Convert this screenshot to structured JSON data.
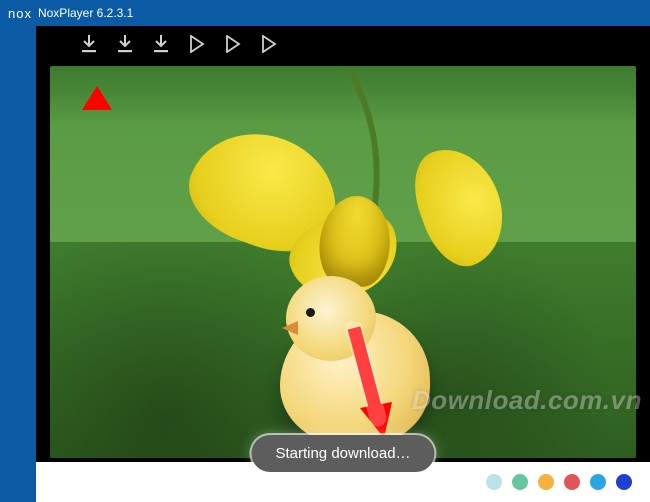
{
  "titlebar": {
    "logo": "nox",
    "title": "NoxPlayer 6.2.3.1"
  },
  "toolbar": {
    "icons": [
      {
        "name": "download-icon",
        "type": "download",
        "active": true
      },
      {
        "name": "download-icon",
        "type": "download",
        "active": false
      },
      {
        "name": "download-icon",
        "type": "download",
        "active": false
      },
      {
        "name": "play-store-icon",
        "type": "play",
        "active": false
      },
      {
        "name": "play-store-icon",
        "type": "play",
        "active": false
      },
      {
        "name": "play-store-icon",
        "type": "play",
        "active": false
      }
    ]
  },
  "toast": {
    "message": "Starting download…"
  },
  "watermark": {
    "text": "Download.com.vn"
  },
  "palette_dots": [
    "#b9e3e8",
    "#63c6a0",
    "#f6b23d",
    "#e0555c",
    "#2aa4e2",
    "#1f3fd1"
  ],
  "colors": {
    "window_chrome": "#0a5aa4",
    "toolbar_bg": "#000000",
    "toast_bg": "#5d5d5d",
    "annotation": "#ff0000"
  },
  "image_content": {
    "description": "Yellow baby chick standing on green grass with a yellow daffodil flower resting on its head like a hat."
  }
}
